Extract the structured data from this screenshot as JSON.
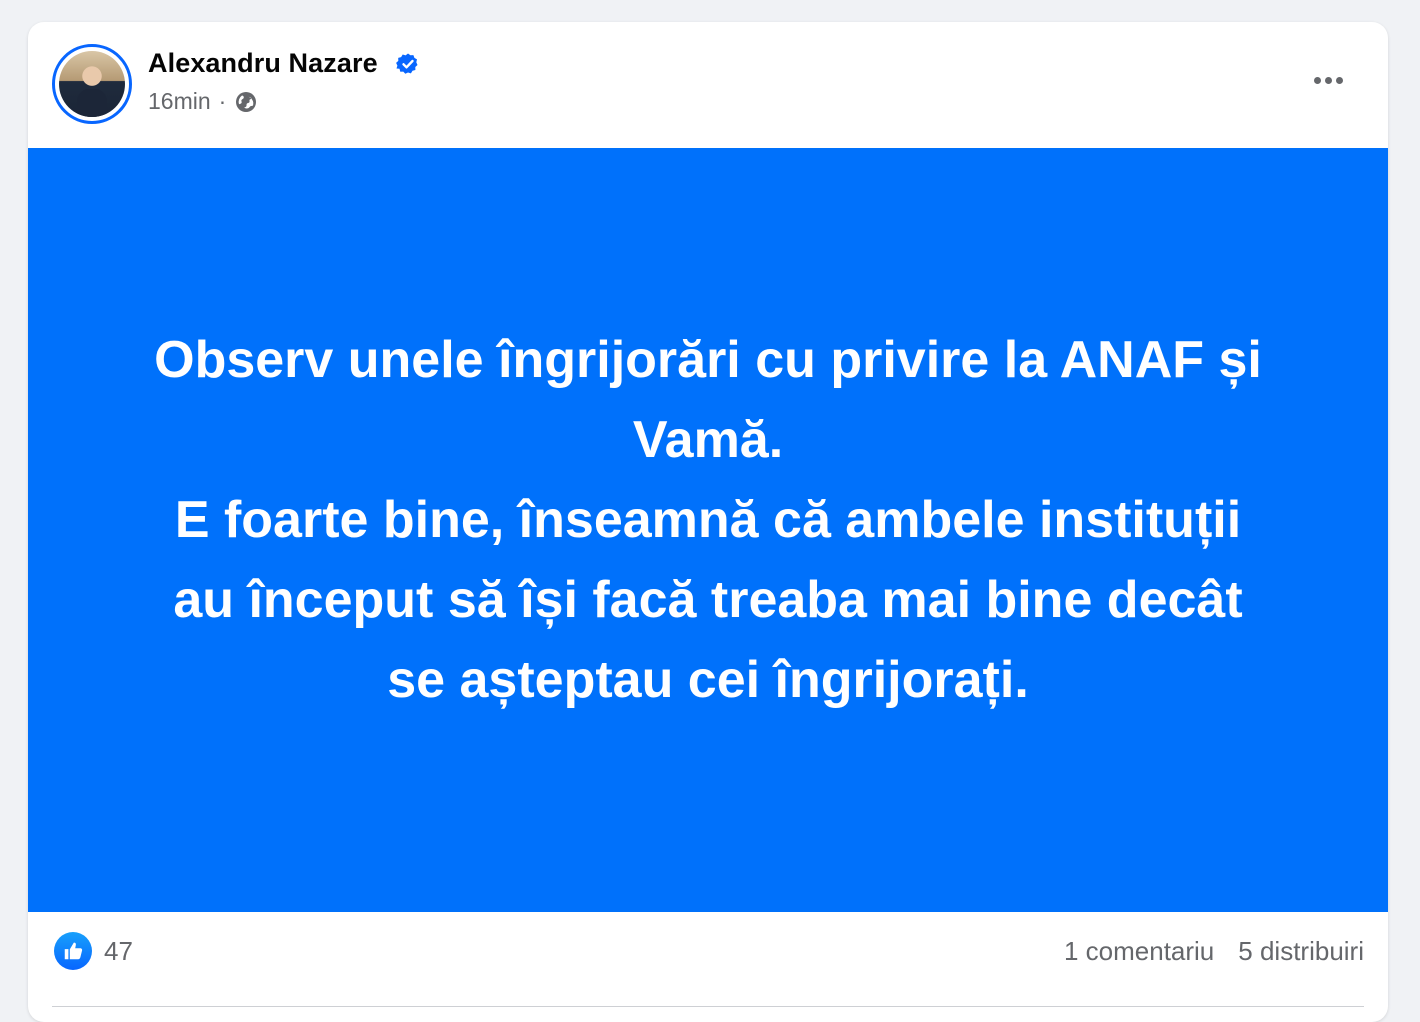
{
  "post": {
    "author": "Alexandru Nazare",
    "time": "16min",
    "separator": "·",
    "privacy_icon": "globe-icon",
    "verified_icon": "verified-badge-icon",
    "background_color": "#0071fb",
    "text_lines": [
      "Observ unele îngrijorări cu privire la ANAF și",
      "Vamă.",
      "E foarte bine, înseamnă că ambele instituții",
      "au început să își facă treaba mai bine decât",
      "se așteptau cei îngrijorați."
    ]
  },
  "footer": {
    "reactions_icon": "like-icon",
    "reaction_count": "47",
    "comments": "1 comentariu",
    "shares": "5 distribuiri"
  }
}
